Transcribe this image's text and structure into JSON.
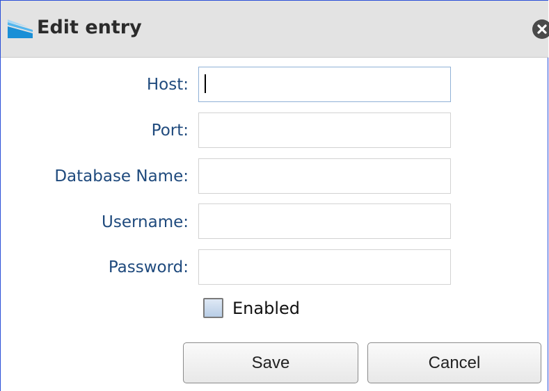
{
  "dialog": {
    "title": "Edit entry",
    "app_icon": "app-logo-icon",
    "close_icon": "close-icon"
  },
  "form": {
    "host_label": "Host:",
    "host_value": "",
    "port_label": "Port:",
    "port_value": "",
    "database_label": "Database Name:",
    "database_value": "",
    "username_label": "Username:",
    "username_value": "",
    "password_label": "Password:",
    "password_value": "",
    "enabled_label": "Enabled",
    "enabled_checked": false
  },
  "buttons": {
    "save_label": "Save",
    "cancel_label": "Cancel"
  },
  "colors": {
    "label_text": "#1f4a7d",
    "titlebar_bg": "#e3e3e3",
    "window_border": "#2a4fd8"
  }
}
